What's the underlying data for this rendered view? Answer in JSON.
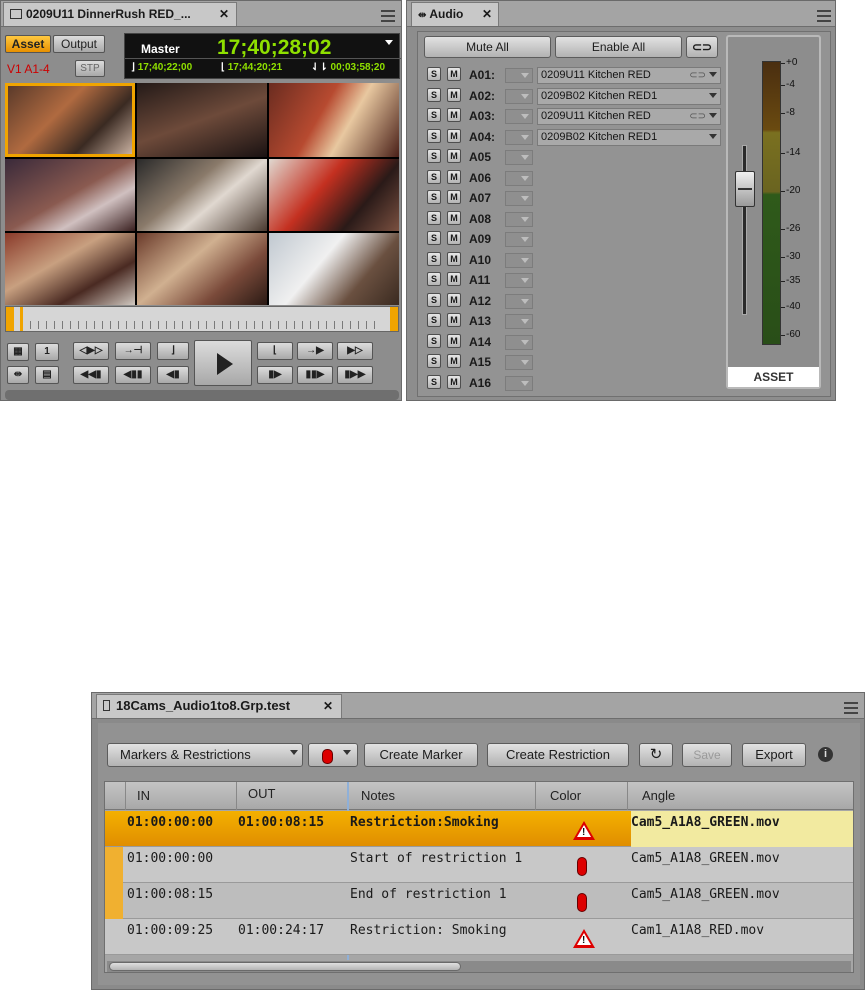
{
  "composer": {
    "tab_title": "0209U11 DinnerRush RED_...",
    "asset_label": "Asset",
    "output_label": "Output",
    "track_label": "V1 A1-4",
    "stp_label": "STP",
    "master_label": "Master",
    "master_tc": "17;40;28;02",
    "tc_in": "17;40;22;00",
    "tc_out": "17;44;20;21",
    "tc_dur": "00;03;58;20",
    "one_label": "1"
  },
  "audio": {
    "tab_title": "Audio",
    "mute_all": "Mute All",
    "enable_all": "Enable All",
    "solo_label": "S",
    "mute_label": "M",
    "tracks": [
      {
        "name": "A01:",
        "source": "0209U11 Kitchen RED"
      },
      {
        "name": "A02:",
        "source": "0209B02 Kitchen RED1"
      },
      {
        "name": "A03:",
        "source": "0209U11 Kitchen RED"
      },
      {
        "name": "A04:",
        "source": "0209B02 Kitchen RED1"
      },
      {
        "name": "A05"
      },
      {
        "name": "A06"
      },
      {
        "name": "A07"
      },
      {
        "name": "A08"
      },
      {
        "name": "A09"
      },
      {
        "name": "A10"
      },
      {
        "name": "A11"
      },
      {
        "name": "A12"
      },
      {
        "name": "A13"
      },
      {
        "name": "A14"
      },
      {
        "name": "A15"
      },
      {
        "name": "A16"
      }
    ],
    "meter_ticks": [
      "+0",
      "-4",
      "-8",
      "-14",
      "-20",
      "-26",
      "-30",
      "-35",
      "-40",
      "-60"
    ],
    "meter_label": "ASSET"
  },
  "markers": {
    "tab_title": "18Cams_Audio1to8.Grp.test",
    "filter_select": "Markers & Restrictions",
    "create_marker": "Create Marker",
    "create_restriction": "Create Restriction",
    "save": "Save",
    "export": "Export",
    "columns": [
      "IN",
      "OUT",
      "Notes",
      "Color",
      "Angle"
    ],
    "rows": [
      {
        "in": "01:00:00:00",
        "out": "01:00:08:15",
        "notes": "Restriction:Smoking",
        "color_icon": "warning-triangle-icon",
        "angle": "Cam5_A1A8_GREEN.mov"
      },
      {
        "in": "01:00:00:00",
        "out": "",
        "notes": "Start of restriction 1",
        "color_icon": "red-marker-icon",
        "angle": "Cam5_A1A8_GREEN.mov"
      },
      {
        "in": "01:00:08:15",
        "out": "",
        "notes": "End of restriction 1",
        "color_icon": "red-marker-icon",
        "angle": "Cam5_A1A8_GREEN.mov"
      },
      {
        "in": "01:00:09:25",
        "out": "01:00:24:17",
        "notes": "Restriction: Smoking",
        "color_icon": "warning-triangle-icon",
        "angle": "Cam1_A1A8_RED.mov"
      }
    ]
  },
  "colors": {
    "accent_orange": "#f0a400",
    "timecode_green": "#8fe000",
    "marker_red": "#dd0000"
  }
}
